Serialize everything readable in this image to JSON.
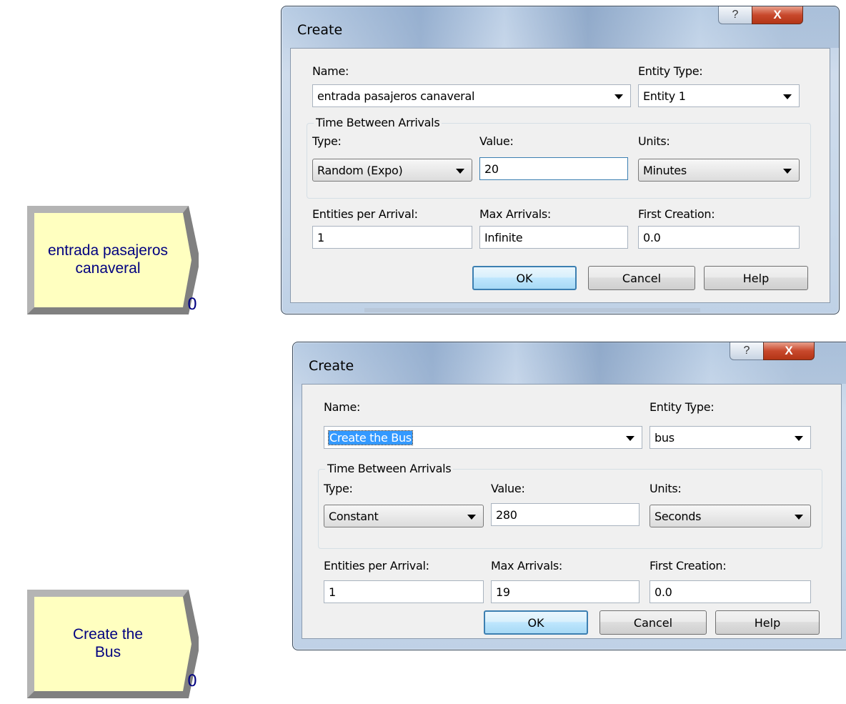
{
  "blocks": [
    {
      "label_line1": "entrada pasajeros",
      "label_line2": "canaveral",
      "counter": "0"
    },
    {
      "label_line1": "Create the",
      "label_line2": "Bus",
      "counter": "0"
    }
  ],
  "dialogs": [
    {
      "title": "Create",
      "help_icon": "?",
      "close_icon": "X",
      "name_label": "Name:",
      "name_value": "entrada pasajeros canaveral",
      "entity_type_label": "Entity Type:",
      "entity_type_value": "Entity 1",
      "group_title": "Time Between Arrivals",
      "type_label": "Type:",
      "type_value": "Random (Expo)",
      "value_label": "Value:",
      "value_value": "20",
      "units_label": "Units:",
      "units_value": "Minutes",
      "entities_label": "Entities per Arrival:",
      "entities_value": "1",
      "max_label": "Max Arrivals:",
      "max_value": "Infinite",
      "first_label": "First Creation:",
      "first_value": "0.0",
      "ok_label": "OK",
      "cancel_label": "Cancel",
      "help_label": "Help"
    },
    {
      "title": "Create",
      "help_icon": "?",
      "close_icon": "X",
      "name_label": "Name:",
      "name_value": "Create the Bus",
      "entity_type_label": "Entity Type:",
      "entity_type_value": "bus",
      "group_title": "Time Between Arrivals",
      "type_label": "Type:",
      "type_value": "Constant",
      "value_label": "Value:",
      "value_value": "280",
      "units_label": "Units:",
      "units_value": "Seconds",
      "entities_label": "Entities per Arrival:",
      "entities_value": "1",
      "max_label": "Max Arrivals:",
      "max_value": "19",
      "first_label": "First Creation:",
      "first_value": "0.0",
      "ok_label": "OK",
      "cancel_label": "Cancel",
      "help_label": "Help"
    }
  ],
  "colors": {
    "block_fill": "#ffffc0",
    "block_text": "#000080",
    "selection": "#3399ff",
    "close_button": "#c8482c"
  }
}
